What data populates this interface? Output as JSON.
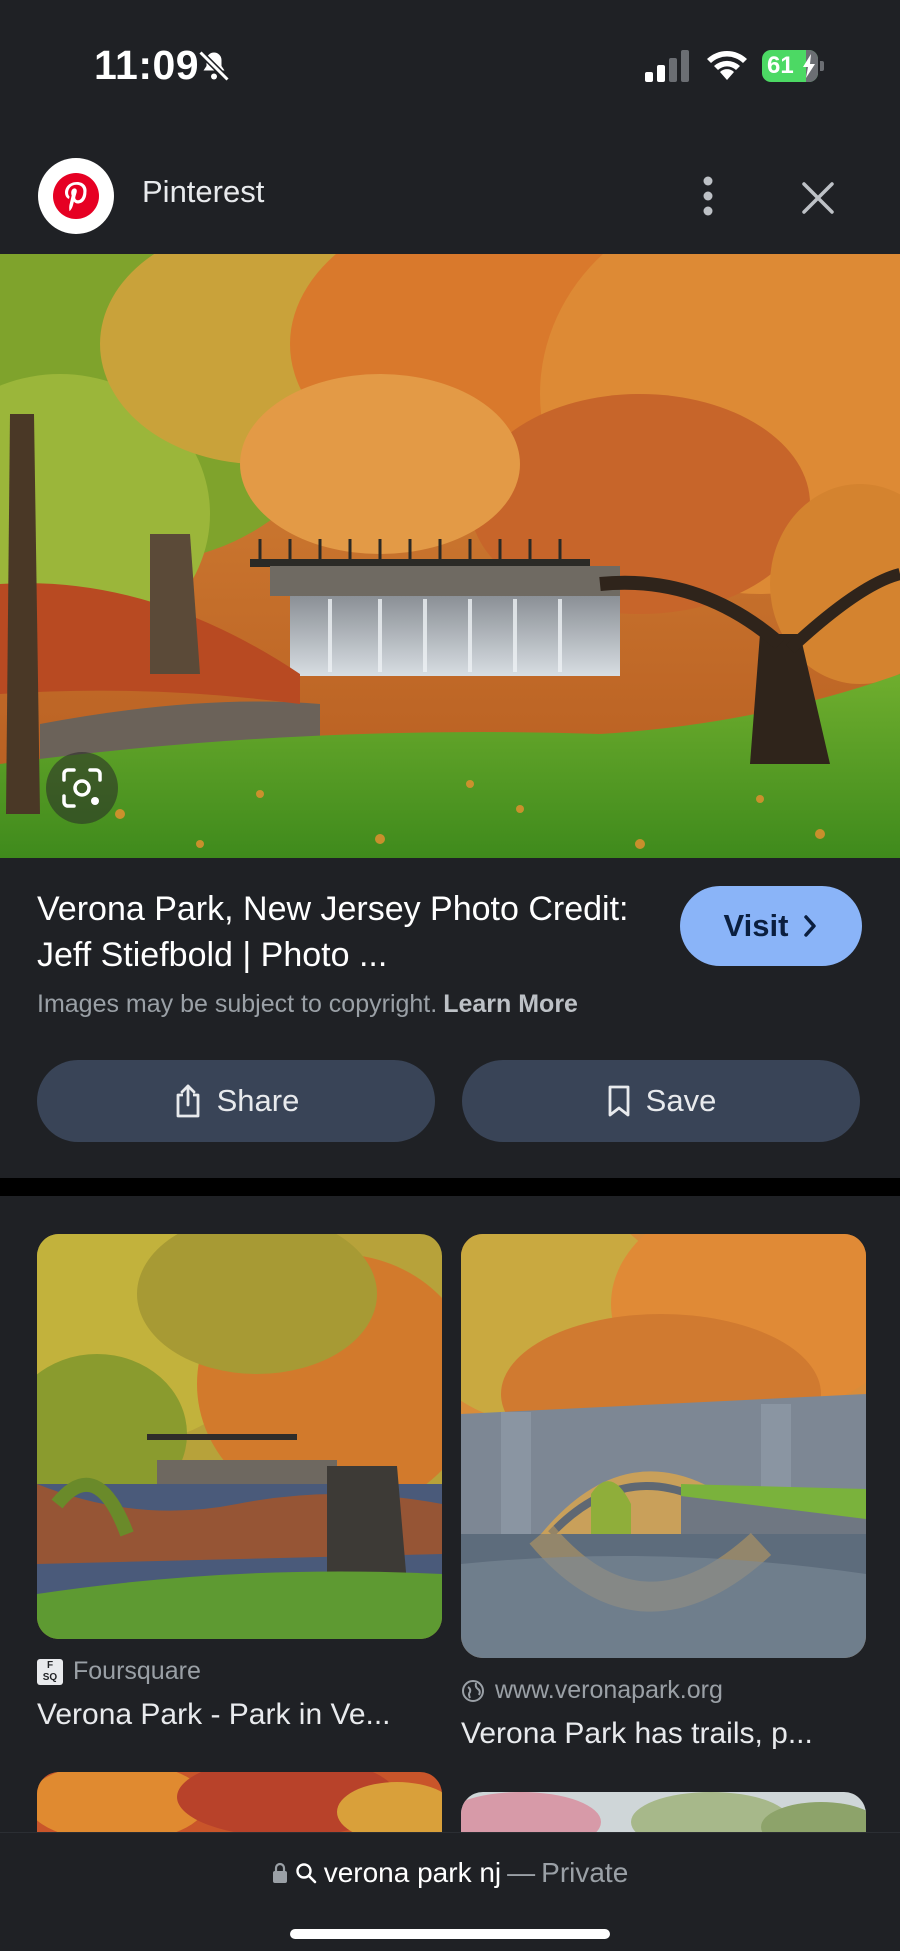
{
  "status": {
    "time": "11:09",
    "battery": "61"
  },
  "source": {
    "name": "Pinterest",
    "logo_icon": "pinterest-logo",
    "brand_color": "#e60023"
  },
  "result": {
    "title": "Verona Park, New Jersey Photo Credit: Jeff Stiefbold | Photo ...",
    "visit_label": "Visit",
    "copyright_text": "Images may be subject to copyright.",
    "learn_more_label": "Learn More",
    "share_label": "Share",
    "save_label": "Save",
    "accent_color": "#8ab4f8"
  },
  "related": [
    {
      "source": "Foursquare",
      "title": "Verona Park - Park in Ve..."
    },
    {
      "source": "www.veronapark.org",
      "title": "Verona Park has trails, p..."
    }
  ],
  "address_bar": {
    "query": "verona park nj",
    "dash": "—",
    "mode": "Private"
  }
}
